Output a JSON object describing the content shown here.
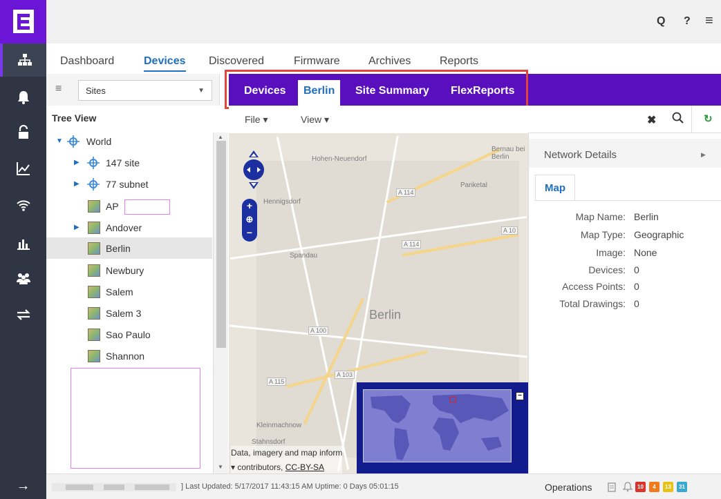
{
  "nav": {
    "items": [
      "network-icon",
      "bell-icon",
      "unlock-icon",
      "chart-line-icon",
      "wifi-icon",
      "bar-chart-icon",
      "users-icon",
      "transfer-icon"
    ],
    "bottom_arrow": "→"
  },
  "topbar": {
    "search_icon": "Q",
    "help": "?",
    "menu": "≡"
  },
  "tabs": [
    "Dashboard",
    "Devices",
    "Discovered",
    "Firmware",
    "Archives",
    "Reports"
  ],
  "active_tab": "Devices",
  "sites": {
    "hamburger": "≡",
    "selected": "Sites"
  },
  "tree": {
    "title": "Tree View",
    "nodes": [
      {
        "label": "World"
      },
      {
        "label": "147 site"
      },
      {
        "label": "77 subnet"
      },
      {
        "label": "AP"
      },
      {
        "label": "Andover"
      },
      {
        "label": "Berlin"
      },
      {
        "label": "Newbury"
      },
      {
        "label": "Salem"
      },
      {
        "label": "Salem 3"
      },
      {
        "label": "Sao Paulo"
      },
      {
        "label": "Shannon"
      }
    ],
    "selected": "Berlin"
  },
  "subtabs": {
    "items": [
      "Devices",
      "Berlin",
      "Site Summary",
      "FlexReports"
    ],
    "active": "Berlin"
  },
  "menus": {
    "file": "File",
    "view": "View"
  },
  "search": {
    "clear": "✖",
    "refresh": "↻"
  },
  "map": {
    "labels": {
      "hohen_neuendorf": "Hohen-Neuendorf",
      "hennigsdorf": "Hennigsdorf",
      "panketal": "Panketal",
      "bernau": "Bernau bei Berlin",
      "spandau": "Spandau",
      "city": "Berlin",
      "kleinmachnow": "Kleinmachnow",
      "stahnsdorf": "Stahnsdorf",
      "a114": "A 114",
      "a10": "A 10",
      "a100": "A 100",
      "a103": "A 103",
      "a115": "A 115"
    },
    "attribution_line1": "Data, imagery and map inform",
    "attribution_prefix": "contributors, ",
    "attribution_link": "CC-BY-SA",
    "overview_collapse": "–"
  },
  "details": {
    "title": "Network Details",
    "tab": "Map",
    "rows": [
      {
        "k": "Map Name:",
        "v": "Berlin"
      },
      {
        "k": "Map Type:",
        "v": "Geographic"
      },
      {
        "k": "Image:",
        "v": "None"
      },
      {
        "k": "Devices:",
        "v": "0"
      },
      {
        "k": "Access Points:",
        "v": "0"
      },
      {
        "k": "Total Drawings:",
        "v": "0"
      }
    ]
  },
  "status": {
    "last_updated": "] Last Updated: 5/17/2017 11:43:15 AM  Uptime: 0 Days 05:01:15",
    "operations": "Operations",
    "badges": [
      {
        "text": "10",
        "color": "#d9342b"
      },
      {
        "text": "4",
        "color": "#f07a1c"
      },
      {
        "text": "13",
        "color": "#e9c217"
      },
      {
        "text": "31",
        "color": "#3aa9cf"
      }
    ]
  }
}
